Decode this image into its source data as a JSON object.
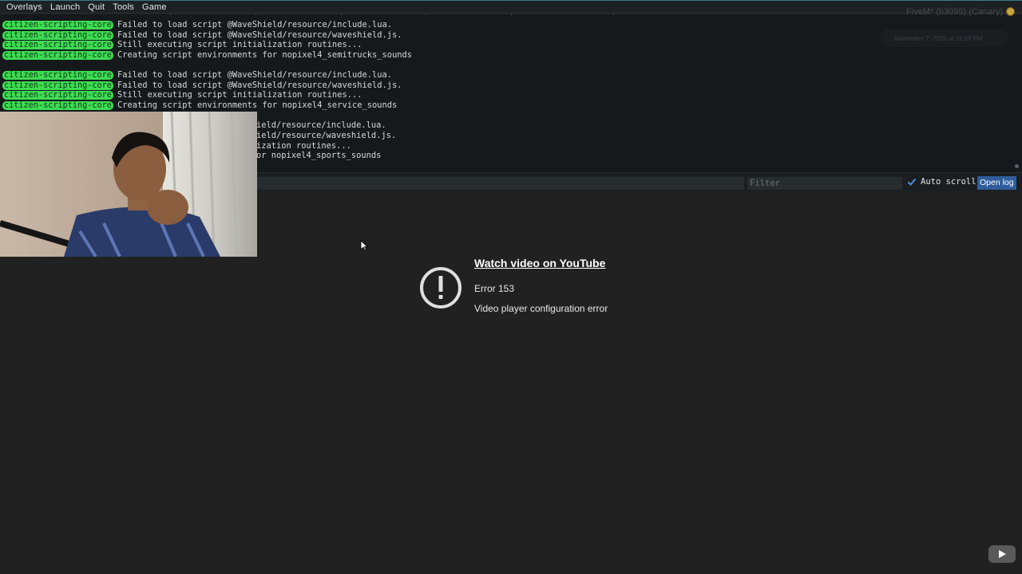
{
  "menu": [
    {
      "label": "Overlays",
      "icon": null
    },
    {
      "label": "Launch",
      "icon": null
    },
    {
      "label": "Quit",
      "icon": null
    },
    {
      "label": "Tools",
      "icon": null
    },
    {
      "label": "Game",
      "icon": null
    }
  ],
  "console": {
    "tag_color": "#3ddc52",
    "lines": [
      {
        "tag": "citizen-scripting-core",
        "text": "Failed to load script @WaveShield/resource/include.lua."
      },
      {
        "tag": "citizen-scripting-core",
        "text": "Failed to load script @WaveShield/resource/waveshield.js."
      },
      {
        "tag": "citizen-scripting-core",
        "text": "Still executing script initialization routines..."
      },
      {
        "tag": "citizen-scripting-core",
        "text": "Creating script environments for nopixel4_semitrucks_sounds"
      },
      {
        "tag": "citizen-scripting-core",
        "text": "Failed to load script @WaveShield/resource/include.lua."
      },
      {
        "tag": "citizen-scripting-core",
        "text": "Failed to load script @WaveShield/resource/waveshield.js."
      },
      {
        "tag": "citizen-scripting-core",
        "text": "Still executing script initialization routines..."
      },
      {
        "tag": "citizen-scripting-core",
        "text": "Creating script environments for nopixel4_service_sounds"
      },
      {
        "tag": "",
        "text": "ield/resource/include.lua."
      },
      {
        "tag": "",
        "text": "ield/resource/waveshield.js."
      },
      {
        "tag": "",
        "text": "ization routines..."
      },
      {
        "tag": "",
        "text": "or nopixel4_sports_sounds"
      }
    ]
  },
  "watermark": {
    "text": "FiveM* (b3095) (Canary)",
    "timestamp": "November 7, 2025 at 11:02 PM"
  },
  "filterbar": {
    "filter_placeholder": "Filter",
    "autoscroll_label": "Auto scroll",
    "autoscroll_checked": true,
    "open_log_label": "Open log"
  },
  "youtube_error": {
    "link_text": "Watch video on YouTube",
    "error_code": "Error 153",
    "error_message": "Video player configuration error",
    "icon": "exclamation-circle-icon"
  },
  "colors": {
    "accent": "#2f5d9c",
    "background": "#212121",
    "console_bg": "#15191c"
  }
}
